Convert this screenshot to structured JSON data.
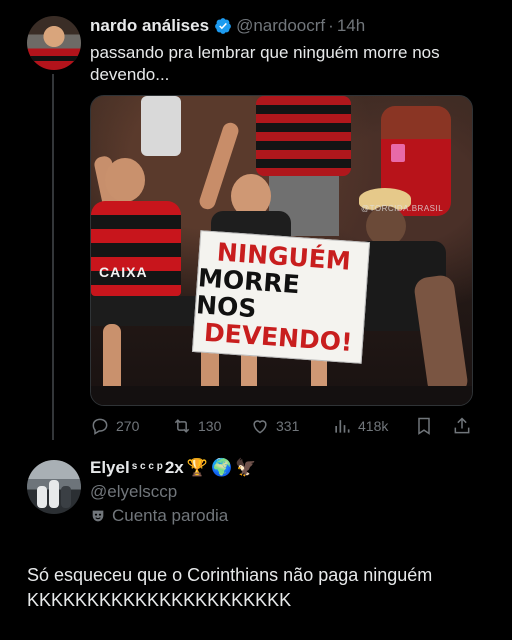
{
  "tweet1": {
    "display_name": "nardo análises",
    "handle": "@nardoocrf",
    "separator": "·",
    "time": "14h",
    "text": "passando pra lembrar que ninguém morre nos devendo...",
    "media": {
      "sign_line1": "NINGUÉM",
      "sign_line2": "MORRE NOS",
      "sign_line3": "DEVENDO!",
      "shirt_text": "CAIXA",
      "watermark": "@TORCIDA.BRASIL"
    },
    "actions": {
      "replies": "270",
      "reposts": "130",
      "likes": "331",
      "views": "418k"
    }
  },
  "tweet2": {
    "display_name": "Elyel",
    "name_superscript": "s c c p",
    "name_suffix": "2x",
    "emojis": [
      "trophy",
      "globe",
      "eagle"
    ],
    "handle": "@elyelsccp",
    "parody_label": "Cuenta parodia",
    "text": "Só esqueceu que o Corinthians não paga ninguém KKKKKKKKKKKKKKKKKKKKKK"
  },
  "colors": {
    "background": "#000000",
    "text": "#e7e9ea",
    "muted": "#71767b",
    "verified": "#1d9bf0",
    "thread_line": "#333639"
  }
}
